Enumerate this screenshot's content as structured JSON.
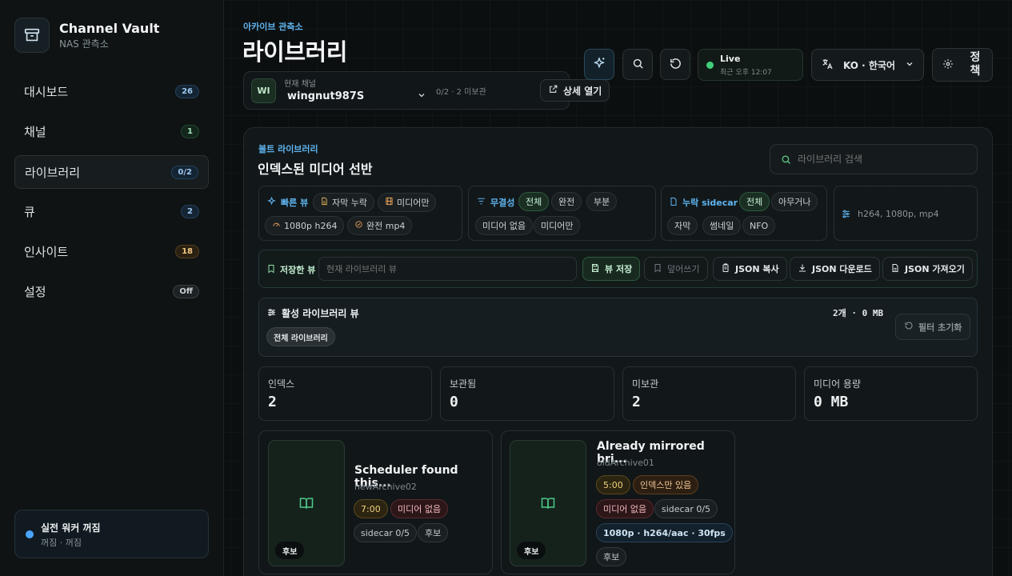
{
  "brand": {
    "title": "Channel Vault",
    "subtitle": "NAS 관측소"
  },
  "nav": [
    {
      "label": "대시보드",
      "badge": "26"
    },
    {
      "label": "채널",
      "badge": "1"
    },
    {
      "label": "라이브러리",
      "badge": "0/2"
    },
    {
      "label": "큐",
      "badge": "2"
    },
    {
      "label": "인사이트",
      "badge": "18"
    },
    {
      "label": "설정",
      "badge": "Off"
    }
  ],
  "worker": {
    "title": "실전 워커 꺼짐",
    "sub": "꺼짐 · 꺼짐"
  },
  "header": {
    "eyebrow": "아카이브 관측소",
    "title": "라이브러리",
    "channel_label": "현재 채널",
    "channel_initials": "WI",
    "channel_name": "wingnut987S",
    "channel_meta": "0/2 · 2 미보관",
    "open_detail": "상세 열기",
    "live_label": "Live",
    "live_time": "최근 오후 12:07",
    "language": "KO · 한국어",
    "policy": "정책"
  },
  "library": {
    "eyebrow": "볼트 라이브러리",
    "title": "인덱스된 미디어 선반",
    "search_placeholder": "라이브러리 검색",
    "quick_view": {
      "label": "빠른 뷰",
      "chips": [
        "자막 누락",
        "미디어만",
        "1080p h264",
        "완전 mp4"
      ]
    },
    "integrity": {
      "label": "무결성",
      "chips": [
        "전체",
        "완전",
        "부분",
        "미디어 없음",
        "미디어만"
      ]
    },
    "sidecar": {
      "label": "누락 sidecar",
      "chips": [
        "전체",
        "아무거나",
        "자막",
        "썸네일",
        "NFO"
      ]
    },
    "format_placeholder": "h264, 1080p, mp4",
    "saved_view": {
      "label": "저장한 뷰",
      "placeholder": "현재 라이브러리 뷰",
      "save": "뷰 저장",
      "overwrite": "덮어쓰기",
      "copy_json": "JSON 복사",
      "download_json": "JSON 다운로드",
      "import_json": "JSON 가져오기"
    },
    "active_view": {
      "label": "활성 라이브러리 뷰",
      "count": "2개 · 0 MB",
      "reset": "필터 초기화",
      "chip": "전체 라이브러리"
    },
    "stats": [
      {
        "label": "인덱스",
        "value": "2"
      },
      {
        "label": "보관됨",
        "value": "0"
      },
      {
        "label": "미보관",
        "value": "2"
      },
      {
        "label": "미디어 용량",
        "value": "0 MB"
      }
    ],
    "cards": [
      {
        "title": "Scheduler found this...",
        "sub": "newArchive02",
        "duration": "7:00",
        "status": "미디어 없음",
        "sidecar": "sidecar 0/5",
        "candidate": "후보",
        "thumb_label": "후보"
      },
      {
        "title": "Already mirrored bri...",
        "sub": "oldArchive01",
        "duration": "5:00",
        "index_only": "인덱스만 있음",
        "status": "미디어 없음",
        "sidecar": "sidecar 0/5",
        "format": "1080p · h264/aac · 30fps",
        "candidate": "후보",
        "thumb_label": "후보"
      }
    ]
  }
}
